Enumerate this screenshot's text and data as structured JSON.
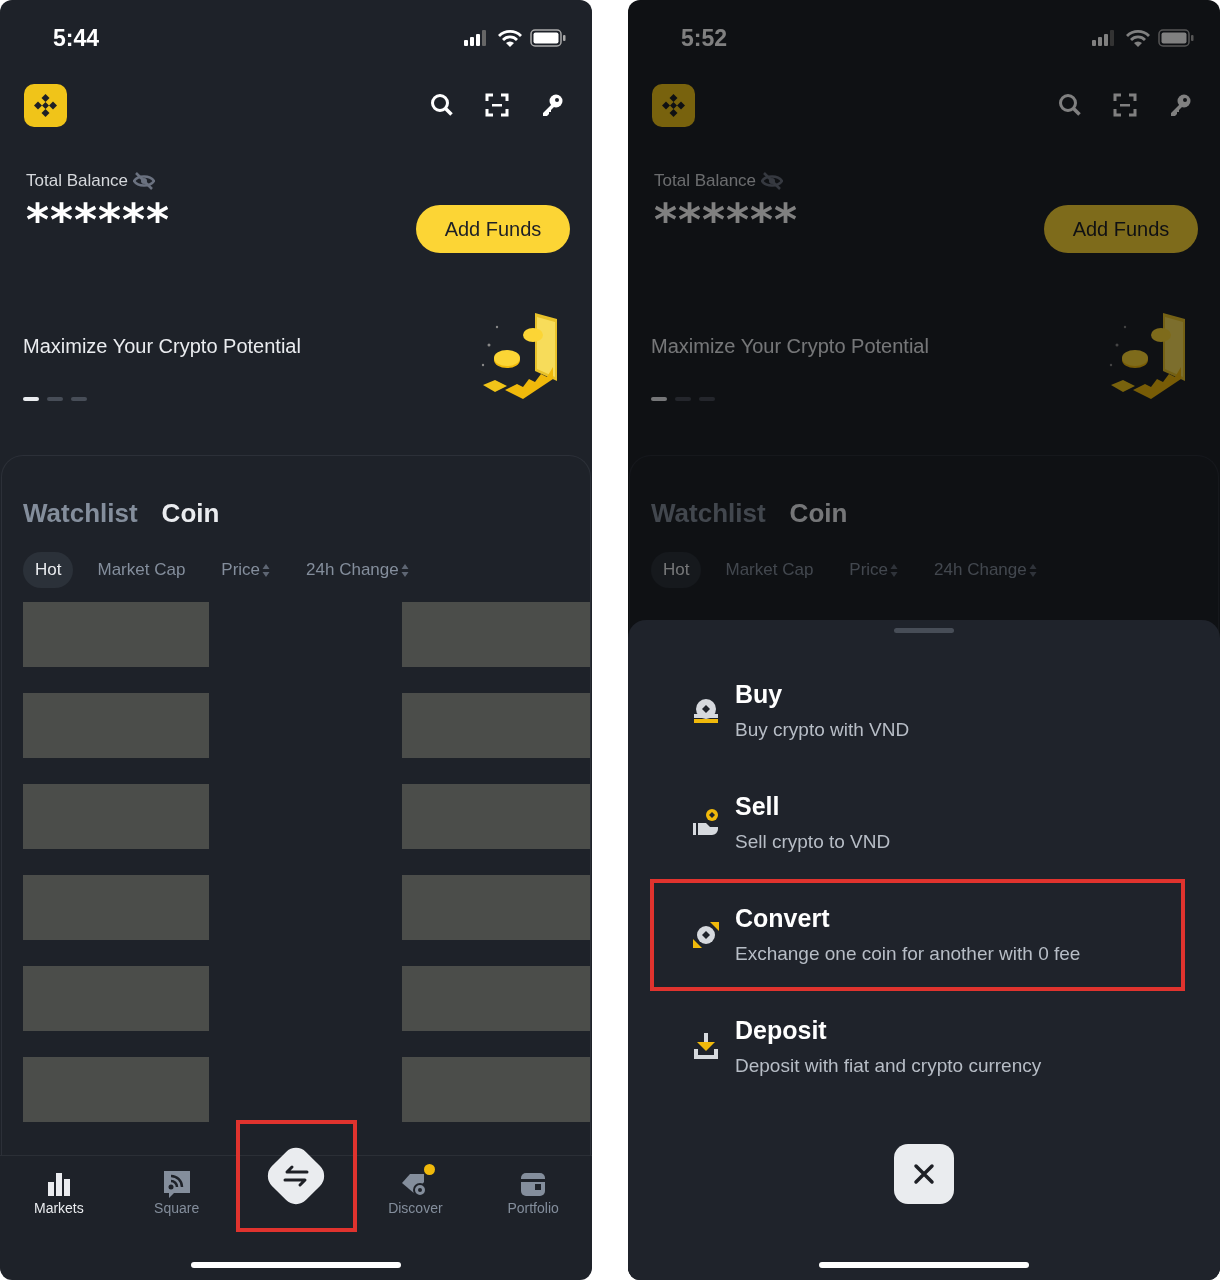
{
  "screens": [
    {
      "status_bar": {
        "time": "5:44"
      },
      "dimmed": false,
      "balance": {
        "label": "Total Balance",
        "value": "******"
      },
      "add_funds_button": "Add Funds",
      "banner": {
        "text": "Maximize Your Crypto Potential",
        "pages": [
          {
            "selected": true
          },
          {
            "selected": false
          },
          {
            "selected": false
          }
        ]
      },
      "section_tabs": [
        {
          "label": "Watchlist",
          "selected": false
        },
        {
          "label": "Coin",
          "selected": true
        }
      ],
      "filters": [
        {
          "label": "Hot",
          "selected": true,
          "sortable": false
        },
        {
          "label": "Market Cap",
          "selected": false,
          "sortable": false
        },
        {
          "label": "Price",
          "selected": false,
          "sortable": true
        },
        {
          "label": "24h Change",
          "selected": false,
          "sortable": true
        }
      ],
      "rows_redacted": true,
      "bottom_nav": [
        {
          "kind": "markets",
          "label": "Markets",
          "selected": true,
          "highlighted": false,
          "badge": false
        },
        {
          "kind": "square",
          "label": "Square",
          "selected": false,
          "highlighted": false,
          "badge": false
        },
        {
          "kind": "trade",
          "selected": false,
          "highlighted": true,
          "badge": false
        },
        {
          "kind": "discover",
          "label": "Discover",
          "selected": false,
          "highlighted": false,
          "badge": true
        },
        {
          "kind": "portfolio",
          "label": "Portfolio",
          "selected": false,
          "highlighted": false,
          "badge": false
        }
      ]
    },
    {
      "status_bar": {
        "time": "5:52"
      },
      "dimmed": true,
      "balance": {
        "label": "Total Balance",
        "value": "******"
      },
      "add_funds_button": "Add Funds",
      "banner": {
        "text": "Maximize Your Crypto Potential",
        "pages": [
          {
            "selected": true
          },
          {
            "selected": false
          },
          {
            "selected": false
          }
        ]
      },
      "section_tabs": [
        {
          "label": "Watchlist",
          "selected": false
        },
        {
          "label": "Coin",
          "selected": true
        }
      ],
      "filters": [
        {
          "label": "Hot",
          "selected": true,
          "sortable": false
        },
        {
          "label": "Market Cap",
          "selected": false,
          "sortable": false
        },
        {
          "label": "Price",
          "selected": false,
          "sortable": true
        },
        {
          "label": "24h Change",
          "selected": false,
          "sortable": true
        }
      ],
      "rows_redacted": false,
      "action_sheet": {
        "actions": [
          {
            "kind": "buy",
            "title": "Buy",
            "subtitle": "Buy crypto with VND",
            "highlighted": false
          },
          {
            "kind": "sell",
            "title": "Sell",
            "subtitle": "Sell crypto to VND",
            "highlighted": false
          },
          {
            "kind": "convert",
            "title": "Convert",
            "subtitle": "Exchange one coin for another with 0 fee",
            "highlighted": true
          },
          {
            "kind": "deposit",
            "title": "Deposit",
            "subtitle": "Deposit with fiat and crypto currency",
            "highlighted": false
          }
        ]
      }
    }
  ]
}
